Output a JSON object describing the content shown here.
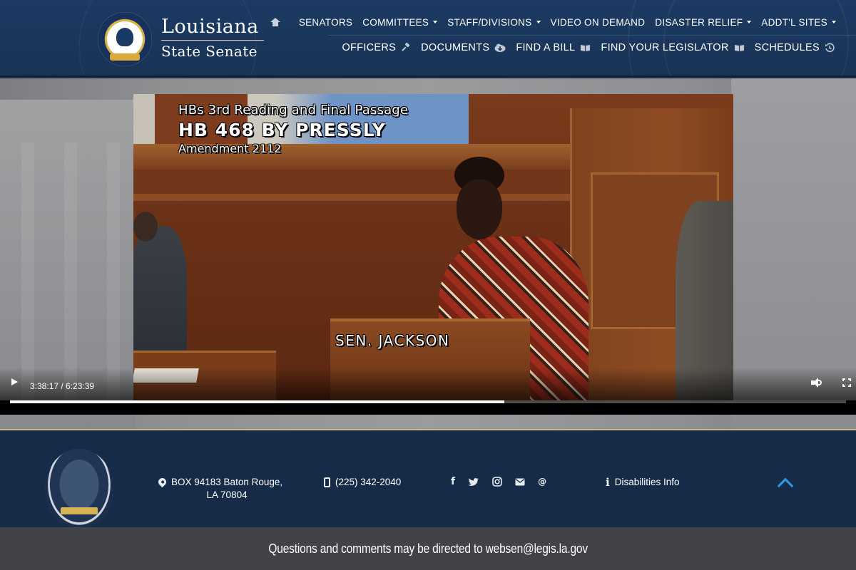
{
  "header": {
    "brand_line1": "Louisiana",
    "brand_line2": "State Senate",
    "nav_primary": [
      "SENATORS",
      "COMMITTEES",
      "STAFF/DIVISIONS",
      "VIDEO ON DEMAND",
      "DISASTER RELIEF",
      "ADDT'L SITES"
    ],
    "nav_secondary": [
      "OFFICERS",
      "DOCUMENTS",
      "FIND A BILL",
      "FIND YOUR LEGISLATOR",
      "SCHEDULES"
    ],
    "icons": {
      "home": "home-icon",
      "officers": "gavel-icon",
      "documents": "cloud-download-icon",
      "find_bill": "book-icon",
      "find_legislator": "book-icon",
      "schedules": "history-icon"
    }
  },
  "video": {
    "overlay_line1": "HBs 3rd Reading and Final Passage",
    "overlay_line2": "HB 468 BY PRESSLY",
    "overlay_line3": "Amendment 2112",
    "speaker_caption": "SEN. JACKSON",
    "current_time": "3:38:17",
    "duration": "6:23:39",
    "time_display": "3:38:17 / 6:23:39",
    "progress_fraction": 0.5914
  },
  "footer": {
    "address_line1": "BOX 94183 Baton Rouge,",
    "address_line2": "LA 70804",
    "phone": "(225) 342-2040",
    "social_icons": [
      "facebook-icon",
      "twitter-icon",
      "instagram-icon",
      "email-icon",
      "at-icon"
    ],
    "disabilities_label": "Disabilities Info",
    "contact_message": "Questions and comments may be directed to websen@legis.la.gov"
  },
  "colors": {
    "header_bg": "#1c3a63",
    "footer_bg": "#152b47",
    "subfooter_bg": "#424346",
    "accent_gold": "#c8b782",
    "to_top_blue": "#2f9ae3"
  }
}
